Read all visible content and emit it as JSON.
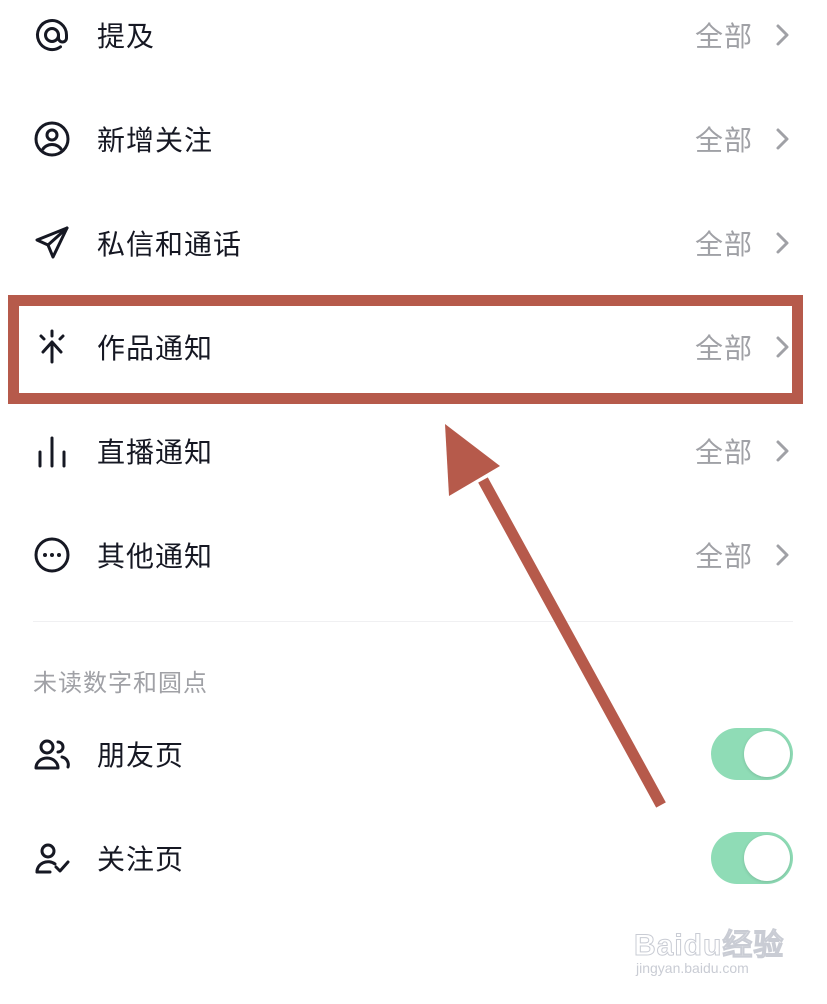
{
  "settings": {
    "rows": [
      {
        "label": "提及",
        "value": "全部",
        "icon": "at-icon"
      },
      {
        "label": "新增关注",
        "value": "全部",
        "icon": "user-circle-icon"
      },
      {
        "label": "私信和通话",
        "value": "全部",
        "icon": "send-icon"
      },
      {
        "label": "作品通知",
        "value": "全部",
        "icon": "sparkle-icon"
      },
      {
        "label": "直播通知",
        "value": "全部",
        "icon": "bars-icon"
      },
      {
        "label": "其他通知",
        "value": "全部",
        "icon": "more-circle-icon"
      }
    ]
  },
  "unread_section": {
    "title": "未读数字和圆点",
    "toggles": [
      {
        "label": "朋友页",
        "on": true,
        "icon": "friends-icon"
      },
      {
        "label": "关注页",
        "on": true,
        "icon": "follow-check-icon"
      }
    ]
  },
  "colors": {
    "highlight": "#b65a4b",
    "toggle_on": "#8fdcb6"
  },
  "watermark": {
    "brand": "Baidu经验",
    "sub": "jingyan.baidu.com"
  }
}
